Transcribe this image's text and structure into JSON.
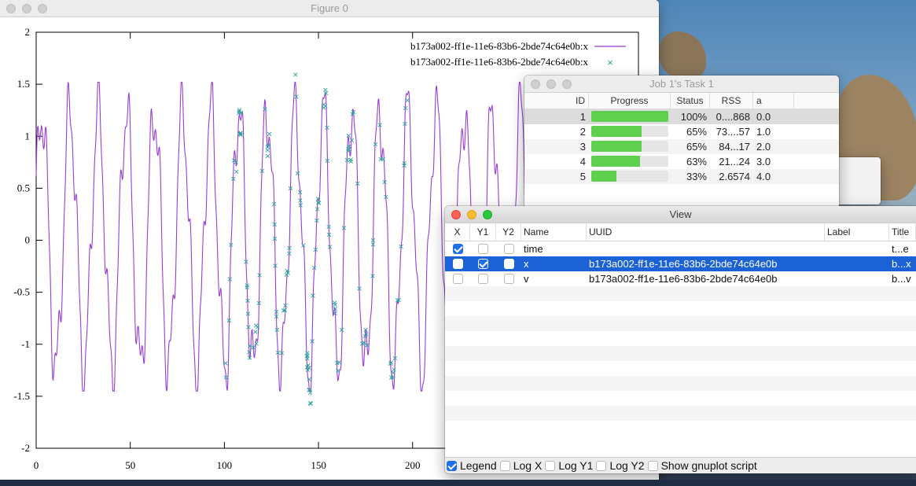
{
  "figure": {
    "title": "Figure 0",
    "legend": [
      "b173a002-ff1e-11e6-83b6-2bde74c64e0b:x",
      "b173a002-ff1e-11e6-83b6-2bde74c64e0b:x"
    ],
    "y_ticks": [
      "2",
      "1.5",
      "1",
      "0.5",
      "0",
      "-0.5",
      "-1",
      "-1.5",
      "-2"
    ],
    "x_ticks": [
      "0",
      "50",
      "100",
      "150",
      "200"
    ],
    "colors": {
      "line": "#9a3dd6",
      "points": "#2aa198"
    }
  },
  "chart_data": {
    "type": "line",
    "xlim": [
      0,
      320
    ],
    "ylim": [
      -2,
      2
    ],
    "series": [
      {
        "name": "b173a002-ff1e-11e6-83b6-2bde74c64e0b:x",
        "style": "line"
      },
      {
        "name": "b173a002-ff1e-11e6-83b6-2bde74c64e0b:x",
        "style": "points"
      }
    ]
  },
  "job": {
    "title": "Job 1's Task 1",
    "columns": [
      "ID",
      "Progress",
      "Status",
      "RSS",
      "a"
    ],
    "rows": [
      {
        "id": "1",
        "progress": 1.0,
        "status": "100%",
        "rss": "0....868",
        "a": "0.0"
      },
      {
        "id": "2",
        "progress": 0.65,
        "status": "65%",
        "rss": "73....57",
        "a": "1.0"
      },
      {
        "id": "3",
        "progress": 0.65,
        "status": "65%",
        "rss": "84...17",
        "a": "2.0"
      },
      {
        "id": "4",
        "progress": 0.63,
        "status": "63%",
        "rss": "21...24",
        "a": "3.0"
      },
      {
        "id": "5",
        "progress": 0.33,
        "status": "33%",
        "rss": "2.6574",
        "a": "4.0"
      }
    ]
  },
  "view": {
    "title": "View",
    "columns": [
      "X",
      "Y1",
      "Y2",
      "Name",
      "UUID",
      "Label",
      "Title"
    ],
    "rows": [
      {
        "x": true,
        "y1": false,
        "y2": false,
        "name": "time",
        "uuid": "",
        "label": "",
        "title": "t...e"
      },
      {
        "x": false,
        "y1": true,
        "y2": false,
        "name": "x",
        "uuid": "b173a002-ff1e-11e6-83b6-2bde74c64e0b",
        "label": "",
        "title": "b...x"
      },
      {
        "x": false,
        "y1": false,
        "y2": false,
        "name": "v",
        "uuid": "b173a002-ff1e-11e6-83b6-2bde74c64e0b",
        "label": "",
        "title": "b...v"
      }
    ],
    "footer": {
      "legend": "Legend",
      "legend_on": true,
      "logx": "Log X",
      "logy1": "Log Y1",
      "logy2": "Log Y2",
      "script": "Show gnuplot script"
    }
  }
}
